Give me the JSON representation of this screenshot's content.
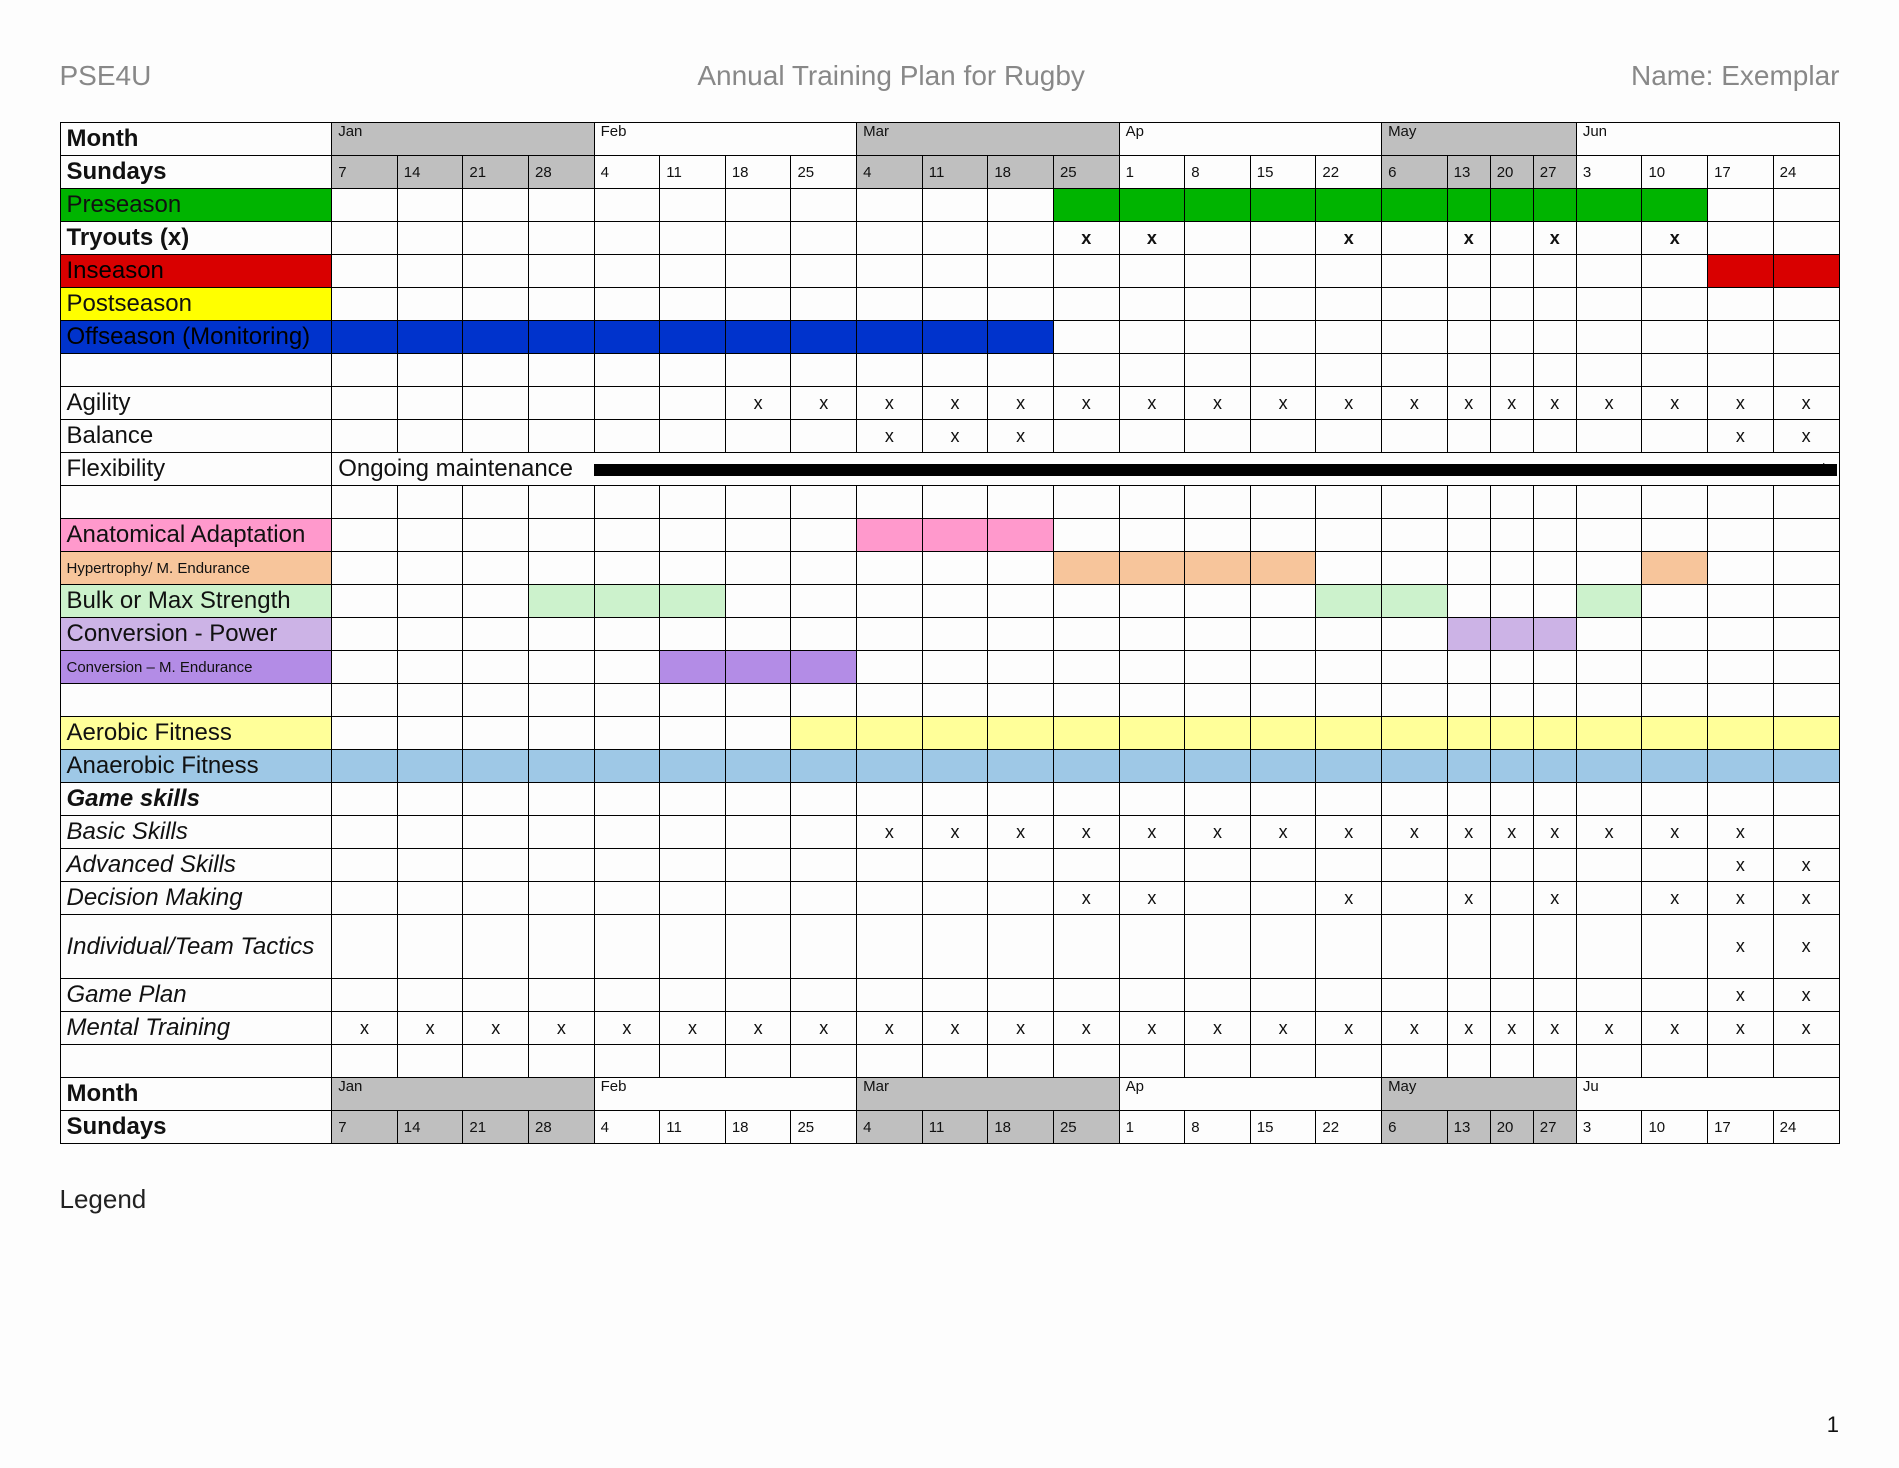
{
  "header": {
    "left": "PSE4U",
    "center": "Annual Training Plan for Rugby",
    "right": "Name: Exemplar"
  },
  "legend": "Legend",
  "page": "1",
  "monthLabelTop": "Month",
  "sundayLabelTop": "Sundays",
  "monthLabelBot": "Month",
  "sundayLabelBot": "Sundays",
  "months": [
    "Jan",
    "",
    "",
    "",
    "Feb",
    "",
    "",
    "",
    "Mar",
    "",
    "",
    "",
    "Ap",
    "",
    "",
    "",
    "May",
    "",
    "",
    "",
    "Jun",
    "",
    "",
    ""
  ],
  "monthsBot": [
    "Jan",
    "",
    "",
    "",
    "Feb",
    "",
    "",
    "",
    "Mar",
    "",
    "",
    "",
    "Ap",
    "",
    "",
    "",
    "May",
    "",
    "",
    "",
    "Ju",
    "",
    "",
    ""
  ],
  "weeks": [
    "7",
    "14",
    "21",
    "28",
    "4",
    "11",
    "18",
    "25",
    "4",
    "11",
    "18",
    "25",
    "1",
    "8",
    "15",
    "22",
    "6",
    "13",
    "20",
    "27",
    "3",
    "10",
    "17",
    "24"
  ],
  "rows": [
    {
      "label": "Preseason",
      "labelFill": "fill-green",
      "fills": {
        "11": "fill-green",
        "12": "fill-green",
        "13": "fill-green",
        "14": "fill-green",
        "15": "fill-green",
        "16": "fill-green",
        "17": "fill-green",
        "18": "fill-green",
        "19": "fill-green",
        "20": "fill-green",
        "21": "fill-green"
      }
    },
    {
      "label": "Tryouts (x)",
      "marks": {
        "11": "x",
        "12": "x",
        "15": "x",
        "17": "x",
        "19": "x",
        "21": "x"
      },
      "bold": true
    },
    {
      "label": "Inseason",
      "labelFill": "fill-red",
      "fills": {
        "22": "fill-red",
        "23": "fill-red"
      }
    },
    {
      "label": "Postseason",
      "labelFill": "fill-yellow"
    },
    {
      "label": "Offseason (Monitoring)",
      "labelFill": "fill-blue",
      "fills": {
        "0": "fill-blue",
        "1": "fill-blue",
        "2": "fill-blue",
        "3": "fill-blue",
        "4": "fill-blue",
        "5": "fill-blue",
        "6": "fill-blue",
        "7": "fill-blue",
        "8": "fill-blue",
        "9": "fill-blue",
        "10": "fill-blue"
      }
    },
    {
      "blank": true
    },
    {
      "label": "Agility",
      "marks": {
        "6": "x",
        "7": "x",
        "8": "x",
        "9": "x",
        "10": "x",
        "11": "x",
        "12": "x",
        "13": "x",
        "14": "x",
        "15": "x",
        "16": "x",
        "17": "x",
        "18": "x",
        "19": "x",
        "20": "x",
        "21": "x",
        "22": "x",
        "23": "x"
      }
    },
    {
      "label": "Balance",
      "marks": {
        "8": "x",
        "9": "x",
        "10": "x",
        "22": "x",
        "23": "x"
      }
    },
    {
      "label": "Flexibility",
      "flex": true,
      "flexText": "Ongoing maintenance"
    },
    {
      "blank": true
    },
    {
      "label": "Anatomical Adaptation",
      "labelFill": "fill-pink",
      "fills": {
        "8": "fill-pink",
        "9": "fill-pink",
        "10": "fill-pink"
      }
    },
    {
      "label": "Hypertrophy/ M. Endurance",
      "labelFill": "fill-orange",
      "small": true,
      "fills": {
        "11": "fill-orange",
        "12": "fill-orange",
        "13": "fill-orange",
        "14": "fill-orange",
        "21": "fill-orange"
      }
    },
    {
      "label": "Bulk or Max Strength",
      "labelFill": "fill-ltgreen",
      "fills": {
        "3": "fill-ltgreen",
        "4": "fill-ltgreen",
        "5": "fill-ltgreen",
        "15": "fill-ltgreen",
        "16": "fill-ltgreen",
        "20": "fill-ltgreen"
      }
    },
    {
      "label": "Conversion - Power",
      "labelFill": "fill-lavender",
      "fills": {
        "17": "fill-lavender",
        "18": "fill-lavender",
        "19": "fill-lavender"
      }
    },
    {
      "label": "Conversion – M. Endurance",
      "labelFill": "fill-purple",
      "small": true,
      "fills": {
        "5": "fill-purple",
        "6": "fill-purple",
        "7": "fill-purple"
      }
    },
    {
      "blank": true
    },
    {
      "label": "Aerobic Fitness",
      "labelFill": "fill-paleyel",
      "fills": {
        "7": "fill-paleyel",
        "8": "fill-paleyel",
        "9": "fill-paleyel",
        "10": "fill-paleyel",
        "11": "fill-paleyel",
        "12": "fill-paleyel",
        "13": "fill-paleyel",
        "14": "fill-paleyel",
        "15": "fill-paleyel",
        "16": "fill-paleyel",
        "17": "fill-paleyel",
        "18": "fill-paleyel",
        "19": "fill-paleyel",
        "20": "fill-paleyel",
        "21": "fill-paleyel",
        "22": "fill-paleyel",
        "23": "fill-paleyel"
      }
    },
    {
      "label": "Anaerobic Fitness",
      "labelFill": "fill-ltblue",
      "fills": {
        "0": "fill-ltblue",
        "1": "fill-ltblue",
        "2": "fill-ltblue",
        "3": "fill-ltblue",
        "4": "fill-ltblue",
        "5": "fill-ltblue",
        "6": "fill-ltblue",
        "7": "fill-ltblue",
        "8": "fill-ltblue",
        "9": "fill-ltblue",
        "10": "fill-ltblue",
        "11": "fill-ltblue",
        "12": "fill-ltblue",
        "13": "fill-ltblue",
        "14": "fill-ltblue",
        "15": "fill-ltblue",
        "16": "fill-ltblue",
        "17": "fill-ltblue",
        "18": "fill-ltblue",
        "19": "fill-ltblue",
        "20": "fill-ltblue",
        "21": "fill-ltblue",
        "22": "fill-ltblue",
        "23": "fill-ltblue"
      }
    },
    {
      "label": "Game skills",
      "boldItal": true
    },
    {
      "label": "Basic Skills",
      "ital": true,
      "marks": {
        "8": "x",
        "9": "x",
        "10": "x",
        "11": "x",
        "12": "x",
        "13": "x",
        "14": "x",
        "15": "x",
        "16": "x",
        "17": "x",
        "18": "x",
        "19": "x",
        "20": "x",
        "21": "x",
        "22": "x"
      }
    },
    {
      "label": "Advanced Skills",
      "ital": true,
      "marks": {
        "22": "x",
        "23": "x"
      }
    },
    {
      "label": "Decision Making",
      "ital": true,
      "marks": {
        "11": "x",
        "12": "x",
        "15": "x",
        "17": "x",
        "19": "x",
        "21": "x",
        "22": "x",
        "23": "x"
      }
    },
    {
      "label": "Individual/Team Tactics",
      "ital": true,
      "tall": true,
      "marks": {
        "22": "x",
        "23": "x"
      }
    },
    {
      "label": "Game Plan",
      "ital": true,
      "marks": {
        "22": "x",
        "23": "x"
      }
    },
    {
      "label": "Mental Training",
      "ital": true,
      "marks": {
        "0": "x",
        "1": "x",
        "2": "x",
        "3": "x",
        "4": "x",
        "5": "x",
        "6": "x",
        "7": "x",
        "8": "x",
        "9": "x",
        "10": "x",
        "11": "x",
        "12": "x",
        "13": "x",
        "14": "x",
        "15": "x",
        "16": "x",
        "17": "x",
        "18": "x",
        "19": "x",
        "20": "x",
        "21": "x",
        "22": "x",
        "23": "x"
      }
    },
    {
      "blank": true
    }
  ],
  "greyWeeks": [
    0,
    1,
    2,
    3,
    8,
    9,
    10,
    11,
    16,
    17,
    18,
    19
  ],
  "narrowCols": [
    17,
    18,
    19
  ]
}
